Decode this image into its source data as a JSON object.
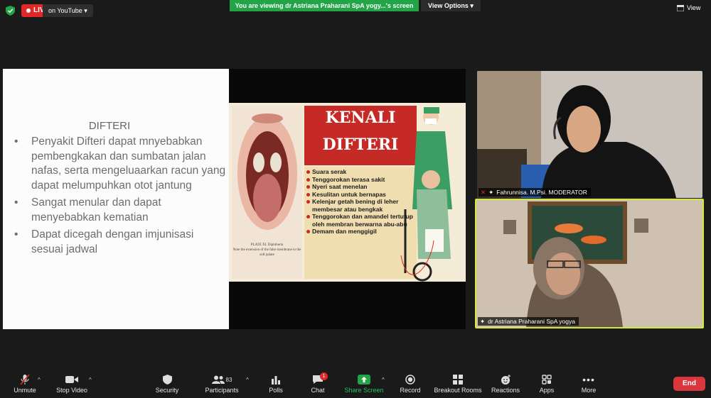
{
  "top_bar": {
    "live_label": "LIVE",
    "live_destination": "on YouTube",
    "viewing_banner": "You are viewing dr Astriana Praharani SpA yogy...'s screen",
    "view_options_label": "View Options",
    "view_label": "View"
  },
  "slide": {
    "title": "DIFTERI",
    "bullets": [
      "Penyakit Difteri dapat mnyebabkan pembengkakan dan sumbatan jalan nafas, serta mengeluaarkan racun yang dapat melumpuhkan otot jantung",
      "Sangat menular dan dapat menyebabkan kematian",
      "Dapat dicegah dengan imjunisasi sesuai jadwal"
    ],
    "poster": {
      "heading_line1": "KENALI",
      "heading_line2": "DIFTERI",
      "plate_title": "PLATE XI. Diphtheria",
      "plate_caption": "Note the extension of the false membrane to the soft palate",
      "symptoms": [
        "Suara serak",
        "Tenggorokan terasa sakit",
        "Nyeri saat menelan",
        "Kesulitan untuk bernapas",
        "Kelenjar getah bening di leher membesar atau bengkak",
        "Tenggorokan dan amandel tertutup oleh membran berwarna abu-abu",
        "Demam dan menggigil"
      ]
    }
  },
  "participants_tiles": [
    {
      "name": "Fahrunnisa. M.Psi. MODERATOR",
      "active_speaker": false
    },
    {
      "name": "dr Astriana Praharani SpA yogya",
      "active_speaker": true
    }
  ],
  "toolbar": {
    "unmute": "Unmute",
    "stop_video": "Stop Video",
    "security": "Security",
    "participants": "Participants",
    "participants_count": "83",
    "polls": "Polls",
    "chat": "Chat",
    "chat_badge": "1",
    "share_screen": "Share Screen",
    "record": "Record",
    "breakout_rooms": "Breakout Rooms",
    "reactions": "Reactions",
    "apps": "Apps",
    "more": "More",
    "end": "End"
  },
  "colors": {
    "live_red": "#e02828",
    "share_green": "#22a447",
    "active_speaker_border": "#d4e83e",
    "end_red": "#d9363e",
    "poster_red": "#c62a26"
  }
}
